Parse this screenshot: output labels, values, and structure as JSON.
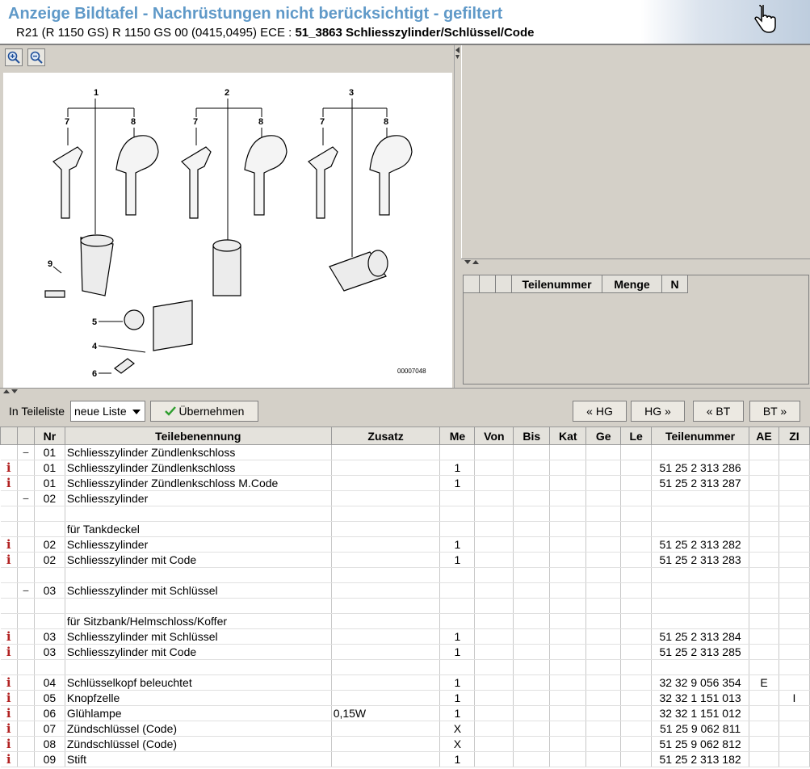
{
  "header": {
    "title": "Anzeige Bildtafel - Nachrüstungen nicht berücksichtigt - gefiltert",
    "subtitle_prefix": "R21 (R 1150 GS) R 1150 GS 00 (0415,0495) ECE : ",
    "subtitle_bold": "51_3863 Schliesszylinder/Schlüssel/Code"
  },
  "drawing": {
    "callouts": [
      "1",
      "2",
      "3",
      "7",
      "8",
      "7",
      "8",
      "7",
      "8",
      "9",
      "5",
      "4",
      "6"
    ],
    "image_number": "00007048"
  },
  "right_grid": {
    "columns": [
      "",
      "",
      "",
      "Teilenummer",
      "Menge",
      "N"
    ]
  },
  "toolbar": {
    "label": "In Teileliste",
    "select_value": "neue Liste",
    "apply_label": "Übernehmen",
    "nav": [
      "« HG",
      "HG »",
      "« BT",
      "BT »"
    ]
  },
  "table": {
    "columns": [
      "",
      "",
      "Nr",
      "Teilebenennung",
      "Zusatz",
      "Me",
      "Von",
      "Bis",
      "Kat",
      "Ge",
      "Le",
      "Teilenummer",
      "AE",
      "ZI"
    ],
    "rows": [
      {
        "i": "",
        "m": "−",
        "nr": "01",
        "name": "Schliesszylinder Zündlenkschloss",
        "zusatz": "",
        "me": "",
        "tn": "",
        "ae": "",
        "zi": ""
      },
      {
        "i": "i",
        "m": "",
        "nr": "01",
        "name": "Schliesszylinder Zündlenkschloss",
        "zusatz": "",
        "me": "1",
        "tn": "51 25 2 313 286",
        "ae": "",
        "zi": ""
      },
      {
        "i": "i",
        "m": "",
        "nr": "01",
        "name": "Schliesszylinder Zündlenkschloss M.Code",
        "zusatz": "",
        "me": "1",
        "tn": "51 25 2 313 287",
        "ae": "",
        "zi": ""
      },
      {
        "i": "",
        "m": "−",
        "nr": "02",
        "name": "Schliesszylinder",
        "zusatz": "",
        "me": "",
        "tn": "",
        "ae": "",
        "zi": ""
      },
      {
        "i": "",
        "m": "",
        "nr": "",
        "name": "",
        "zusatz": "",
        "me": "",
        "tn": "",
        "ae": "",
        "zi": ""
      },
      {
        "i": "",
        "m": "",
        "nr": "",
        "name": "für Tankdeckel",
        "zusatz": "",
        "me": "",
        "tn": "",
        "ae": "",
        "zi": ""
      },
      {
        "i": "i",
        "m": "",
        "nr": "02",
        "name": "Schliesszylinder",
        "zusatz": "",
        "me": "1",
        "tn": "51 25 2 313 282",
        "ae": "",
        "zi": ""
      },
      {
        "i": "i",
        "m": "",
        "nr": "02",
        "name": "Schliesszylinder mit Code",
        "zusatz": "",
        "me": "1",
        "tn": "51 25 2 313 283",
        "ae": "",
        "zi": ""
      },
      {
        "i": "",
        "m": "",
        "nr": "",
        "name": "",
        "zusatz": "",
        "me": "",
        "tn": "",
        "ae": "",
        "zi": ""
      },
      {
        "i": "",
        "m": "−",
        "nr": "03",
        "name": "Schliesszylinder mit Schlüssel",
        "zusatz": "",
        "me": "",
        "tn": "",
        "ae": "",
        "zi": ""
      },
      {
        "i": "",
        "m": "",
        "nr": "",
        "name": "",
        "zusatz": "",
        "me": "",
        "tn": "",
        "ae": "",
        "zi": ""
      },
      {
        "i": "",
        "m": "",
        "nr": "",
        "name": "für Sitzbank/Helmschloss/Koffer",
        "zusatz": "",
        "me": "",
        "tn": "",
        "ae": "",
        "zi": ""
      },
      {
        "i": "i",
        "m": "",
        "nr": "03",
        "name": "Schliesszylinder mit Schlüssel",
        "zusatz": "",
        "me": "1",
        "tn": "51 25 2 313 284",
        "ae": "",
        "zi": ""
      },
      {
        "i": "i",
        "m": "",
        "nr": "03",
        "name": "Schliesszylinder mit Code",
        "zusatz": "",
        "me": "1",
        "tn": "51 25 2 313 285",
        "ae": "",
        "zi": ""
      },
      {
        "i": "",
        "m": "",
        "nr": "",
        "name": "",
        "zusatz": "",
        "me": "",
        "tn": "",
        "ae": "",
        "zi": ""
      },
      {
        "i": "i",
        "m": "",
        "nr": "04",
        "name": "Schlüsselkopf beleuchtet",
        "zusatz": "",
        "me": "1",
        "tn": "32 32 9 056 354",
        "ae": "E",
        "zi": ""
      },
      {
        "i": "i",
        "m": "",
        "nr": "05",
        "name": "Knopfzelle",
        "zusatz": "",
        "me": "1",
        "tn": "32 32 1 151 013",
        "ae": "",
        "zi": "I"
      },
      {
        "i": "i",
        "m": "",
        "nr": "06",
        "name": "Glühlampe",
        "zusatz": "0,15W",
        "me": "1",
        "tn": "32 32 1 151 012",
        "ae": "",
        "zi": ""
      },
      {
        "i": "i",
        "m": "",
        "nr": "07",
        "name": "Zündschlüssel (Code)",
        "zusatz": "",
        "me": "X",
        "tn": "51 25 9 062 811",
        "ae": "",
        "zi": ""
      },
      {
        "i": "i",
        "m": "",
        "nr": "08",
        "name": "Zündschlüssel (Code)",
        "zusatz": "",
        "me": "X",
        "tn": "51 25 9 062 812",
        "ae": "",
        "zi": ""
      },
      {
        "i": "i",
        "m": "",
        "nr": "09",
        "name": "Stift",
        "zusatz": "",
        "me": "1",
        "tn": "51 25 2 313 182",
        "ae": "",
        "zi": ""
      }
    ]
  },
  "icons": {
    "zoom_in": "zoom-in-icon",
    "zoom_out": "zoom-out-icon",
    "check": "check-icon",
    "info": "info-icon",
    "collapse": "minus-icon",
    "dropdown": "chevron-down-icon",
    "cursor": "hand-cursor-icon"
  },
  "colors": {
    "title": "#5f99c8",
    "info": "#b22222",
    "check": "#2e9e2e"
  }
}
